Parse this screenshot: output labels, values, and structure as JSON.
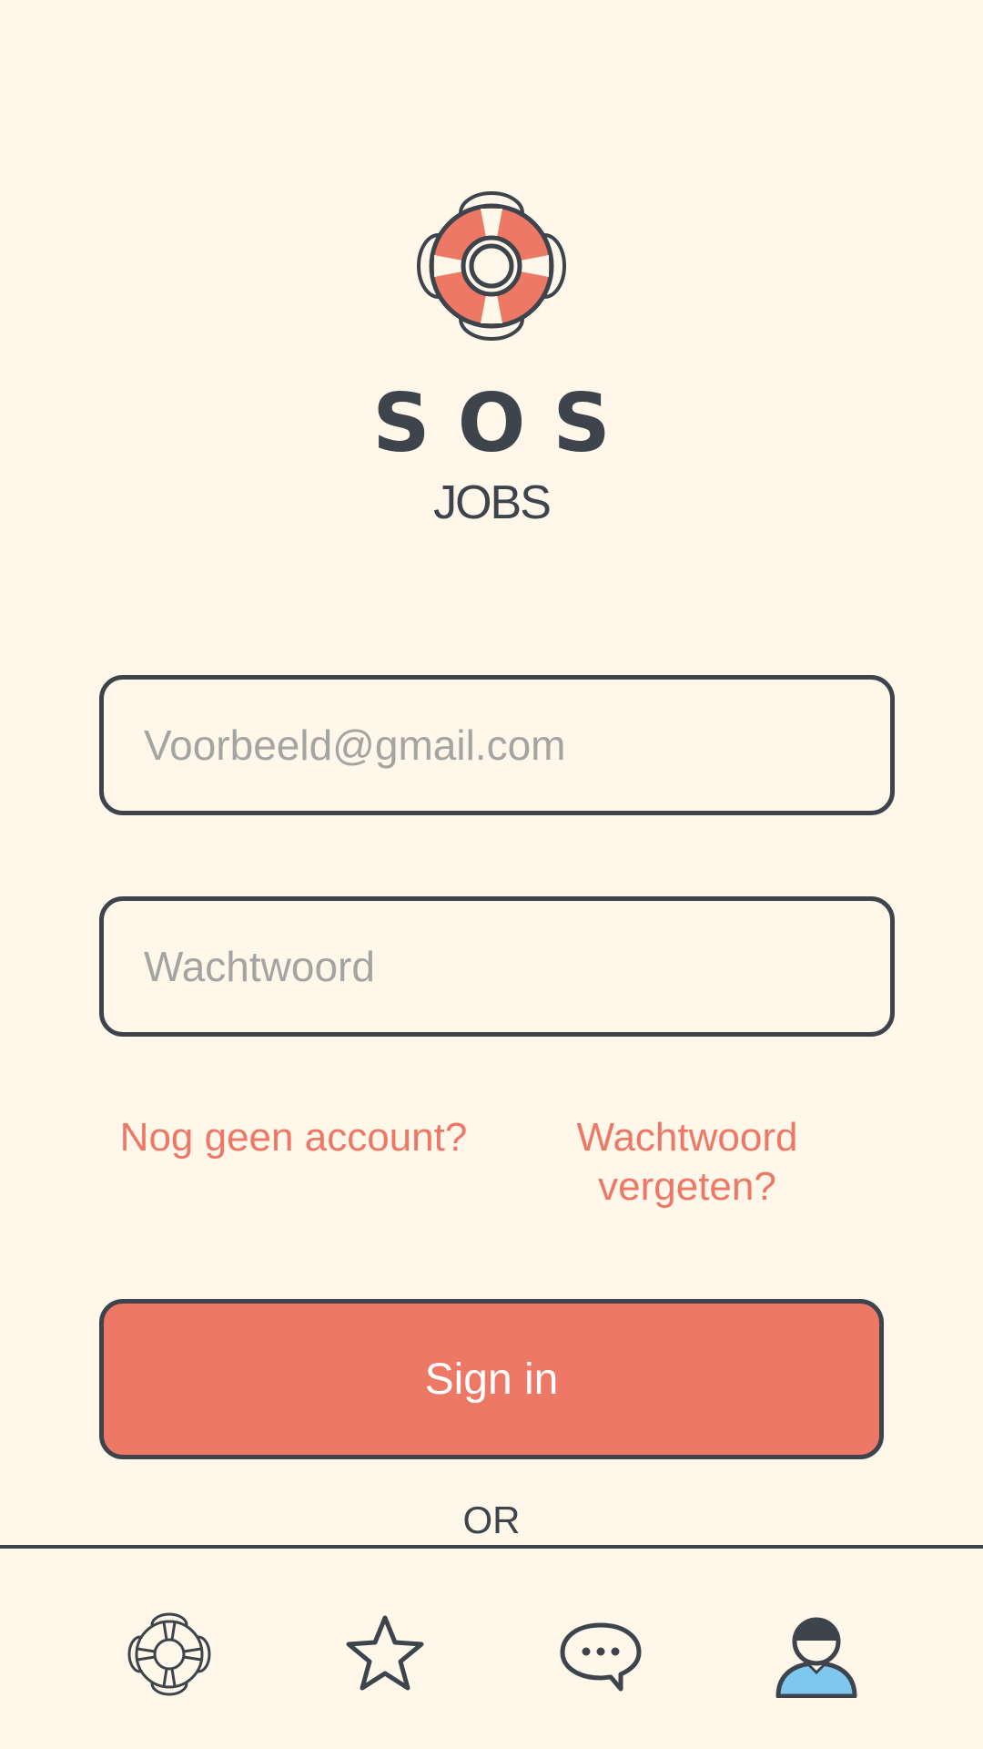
{
  "brand": {
    "title": "SOS",
    "subtitle": "JOBS",
    "logo_icon": "lifebuoy-icon"
  },
  "login_form": {
    "email_placeholder": "Voorbeeld@gmail.com",
    "email_value": "",
    "password_placeholder": "Wachtwoord",
    "password_value": "",
    "register_link": "Nog geen account?",
    "forgot_password_link": "Wachtwoord vergeten?",
    "sign_in_label": "Sign in",
    "or_label": "OR"
  },
  "bottom_nav": {
    "items": [
      {
        "icon": "lifebuoy-icon",
        "active": false
      },
      {
        "icon": "star-icon",
        "active": false
      },
      {
        "icon": "chat-bubble-icon",
        "active": false
      },
      {
        "icon": "user-profile-icon",
        "active": true
      }
    ]
  },
  "colors": {
    "background": "#fef7ea",
    "accent": "#ee7866",
    "outline": "#3d444c",
    "placeholder": "#a4a4a0",
    "profile_blue": "#7ec8f0"
  }
}
